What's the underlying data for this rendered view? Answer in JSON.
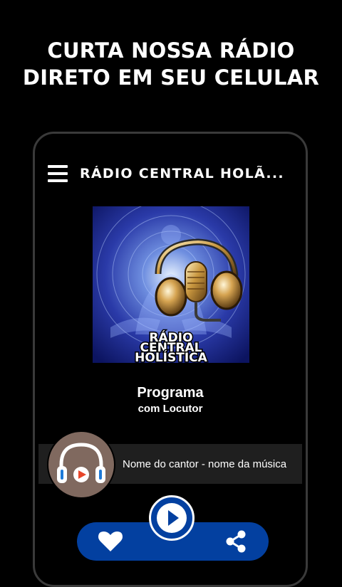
{
  "promo": {
    "line1": "CURTA NOSSA RÁDIO",
    "line2": "DIRETO EM SEU CELULAR"
  },
  "appbar": {
    "title": "RÁDIO CENTRAL HOLÃ...",
    "menu_icon": "hamburger-menu-icon"
  },
  "cover": {
    "lines": [
      "RÁDIO",
      "CENTRAL",
      "HOLÍSTICA"
    ]
  },
  "program": {
    "title": "Programa",
    "host": "com Locutor"
  },
  "now_playing": {
    "text": "Nome do cantor - nome da música",
    "icon": "headphones-icon"
  },
  "controls": {
    "favorite_icon": "heart-icon",
    "play_icon": "play-icon",
    "share_icon": "share-icon"
  },
  "colors": {
    "accent": "#0340a0",
    "badge": "#80695f",
    "now_bar": "#1f1f1f",
    "background": "#000000"
  }
}
